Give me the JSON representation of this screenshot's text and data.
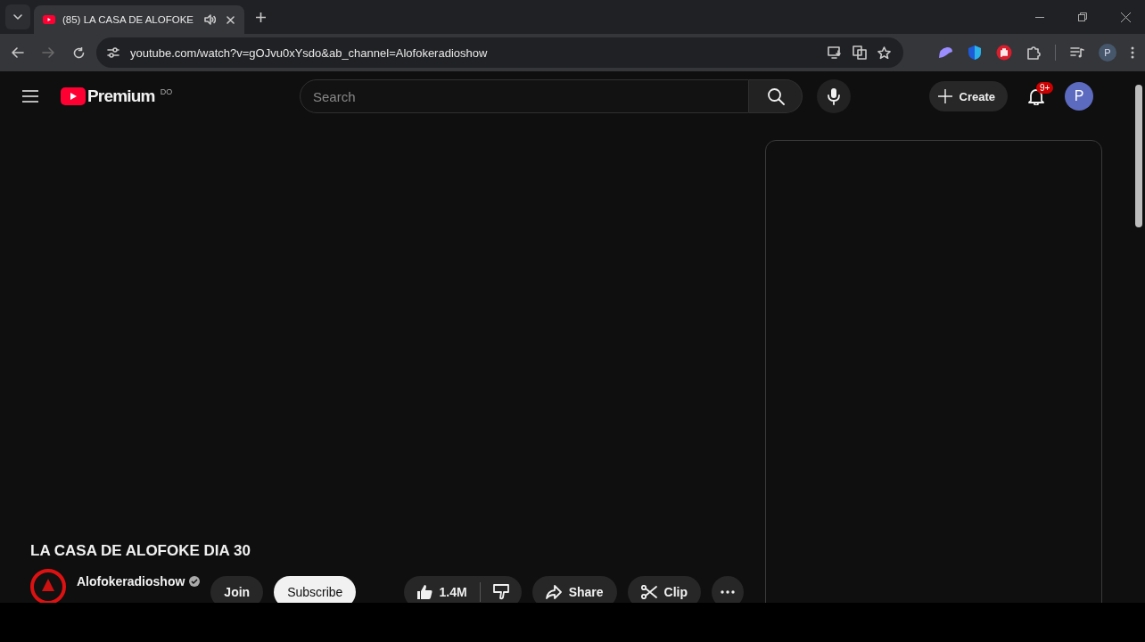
{
  "browser": {
    "tabs": [
      {
        "title": "(85) LA CASA DE ALOFOKE",
        "selected": true
      }
    ],
    "url": "youtube.com/watch?v=gOJvu0xYsdo&ab_channel=Alofokeradioshow",
    "profile": "P"
  },
  "header": {
    "logo": "Premium",
    "country": "DO",
    "search": {
      "placeholder": "Search"
    },
    "create": "Create",
    "notifications": "9+",
    "avatar": "P"
  },
  "video": {
    "title": "LA CASA DE ALOFOKE DIA 30",
    "channel": "Alofokeradioshow",
    "verified": true,
    "join": "Join",
    "subscribe": "Subscribe",
    "likes": "1.4M",
    "share": "Share",
    "clip": "Clip"
  }
}
